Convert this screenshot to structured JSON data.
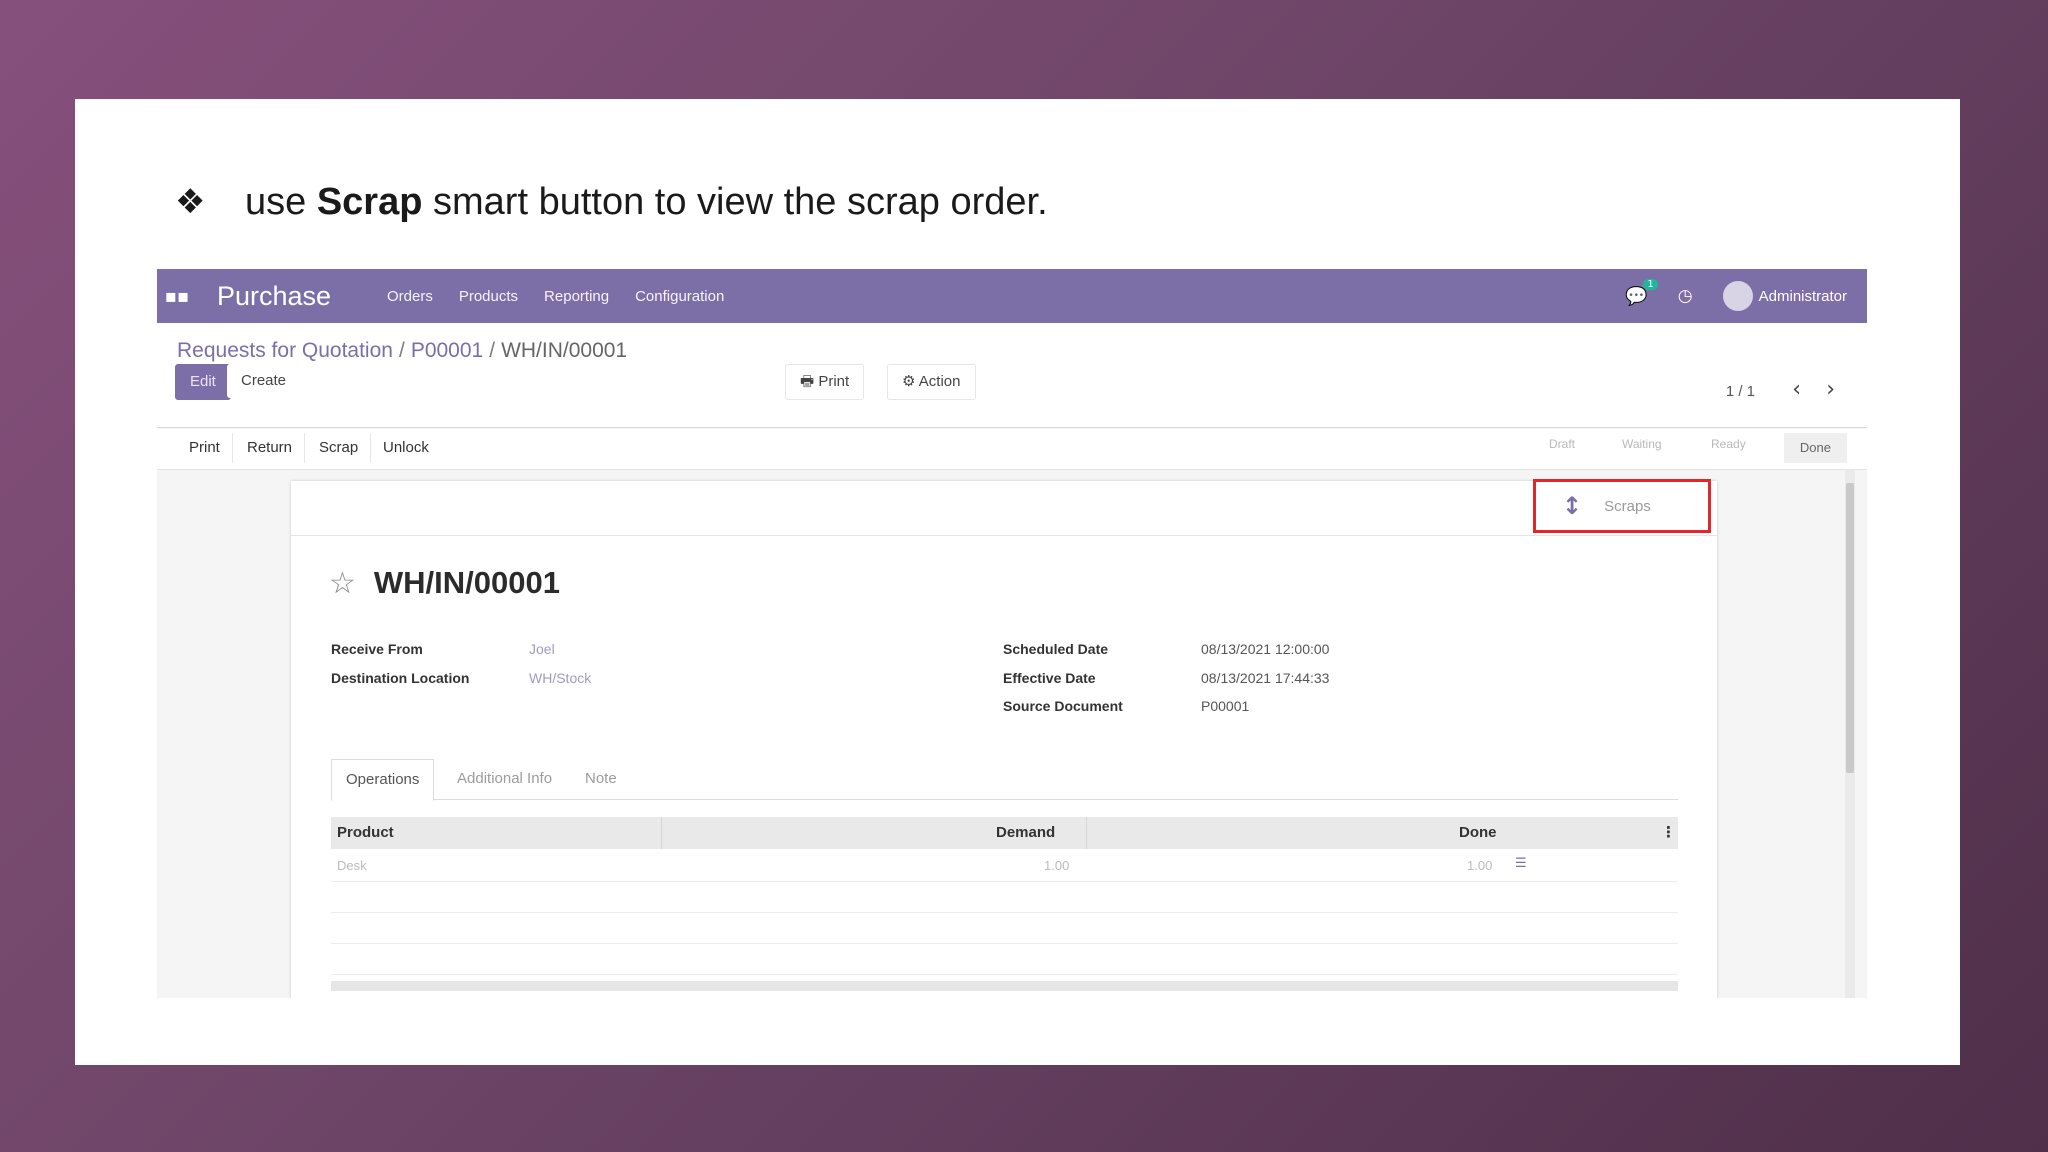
{
  "slide": {
    "bullet_symbol": "❖",
    "instruction_before": "use ",
    "instruction_bold": "Scrap",
    "instruction_after": " smart button to view the scrap order."
  },
  "navbar": {
    "app_title": "Purchase",
    "menu": [
      "Orders",
      "Products",
      "Reporting",
      "Configuration"
    ],
    "chat_badge": "1",
    "user_name": "Administrator"
  },
  "breadcrumb": [
    "Requests for Quotation",
    "P00001",
    "WH/IN/00001"
  ],
  "toolbar": {
    "edit_label": "Edit",
    "create_label": "Create",
    "print_label": "Print",
    "action_label": "Action",
    "pager": "1 / 1"
  },
  "header_buttons": [
    "Print",
    "Return",
    "Scrap",
    "Unlock"
  ],
  "status_stages": [
    "Draft",
    "Waiting",
    "Ready",
    "Done"
  ],
  "smart_button": {
    "label": "Scraps"
  },
  "record": {
    "name": "WH/IN/00001",
    "receive_from_label": "Receive From",
    "receive_from": "Joel",
    "destination_label": "Destination Location",
    "destination": "WH/Stock",
    "scheduled_date_label": "Scheduled Date",
    "scheduled_date": "08/13/2021 12:00:00",
    "effective_date_label": "Effective Date",
    "effective_date": "08/13/2021 17:44:33",
    "source_document_label": "Source Document",
    "source_document": "P00001"
  },
  "tabs": [
    "Operations",
    "Additional Info",
    "Note"
  ],
  "table": {
    "columns": [
      "Product",
      "Demand",
      "Done"
    ],
    "rows": [
      {
        "product": "Desk",
        "demand": "1.00",
        "done": "1.00"
      }
    ]
  },
  "colors": {
    "brand": "#7c6fa8",
    "highlight": "#e3262b"
  }
}
